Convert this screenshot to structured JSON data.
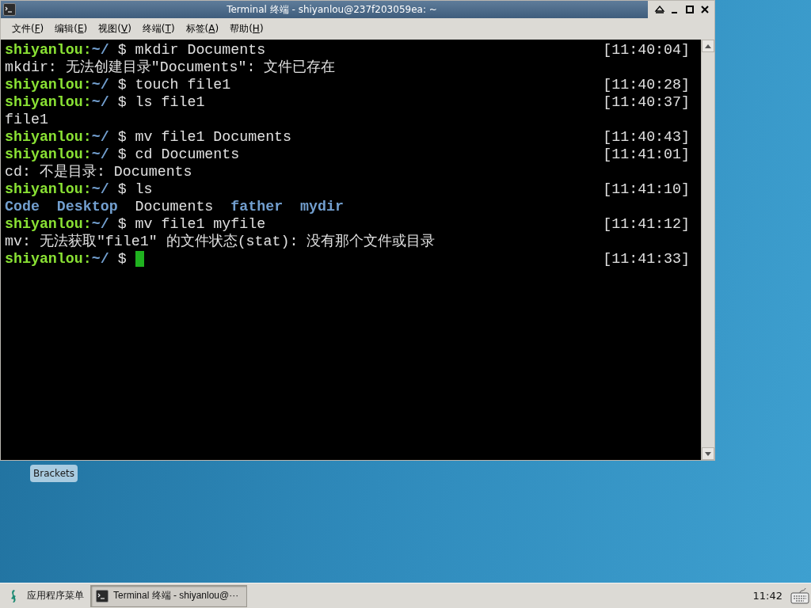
{
  "window": {
    "title": "Terminal 终端 - shiyanlou@237f203059ea: ~"
  },
  "menu": [
    "文件(F)",
    "编辑(E)",
    "视图(V)",
    "终端(T)",
    "标签(A)",
    "帮助(H)"
  ],
  "terminal": {
    "lines": [
      {
        "segments": [
          {
            "kind": "user",
            "text": "shiyanlou:"
          },
          {
            "kind": "path",
            "text": "~/"
          },
          {
            "kind": "plain",
            "text": " $ mkdir Documents"
          }
        ],
        "time": "[11:40:04]"
      },
      {
        "segments": [
          {
            "kind": "plain",
            "text": "mkdir: 无法创建目录\"Documents\": 文件已存在"
          }
        ]
      },
      {
        "segments": [
          {
            "kind": "user",
            "text": "shiyanlou:"
          },
          {
            "kind": "path",
            "text": "~/"
          },
          {
            "kind": "plain",
            "text": " $ touch file1"
          }
        ],
        "time": "[11:40:28]"
      },
      {
        "segments": [
          {
            "kind": "user",
            "text": "shiyanlou:"
          },
          {
            "kind": "path",
            "text": "~/"
          },
          {
            "kind": "plain",
            "text": " $ ls file1"
          }
        ],
        "time": "[11:40:37]"
      },
      {
        "segments": [
          {
            "kind": "plain",
            "text": "file1"
          }
        ]
      },
      {
        "segments": [
          {
            "kind": "user",
            "text": "shiyanlou:"
          },
          {
            "kind": "path",
            "text": "~/"
          },
          {
            "kind": "plain",
            "text": " $ mv file1 Documents"
          }
        ],
        "time": "[11:40:43]"
      },
      {
        "segments": [
          {
            "kind": "user",
            "text": "shiyanlou:"
          },
          {
            "kind": "path",
            "text": "~/"
          },
          {
            "kind": "plain",
            "text": " $ cd Documents"
          }
        ],
        "time": "[11:41:01]"
      },
      {
        "segments": [
          {
            "kind": "plain",
            "text": "cd: 不是目录: Documents"
          }
        ]
      },
      {
        "segments": [
          {
            "kind": "user",
            "text": "shiyanlou:"
          },
          {
            "kind": "path",
            "text": "~/"
          },
          {
            "kind": "plain",
            "text": " $ ls"
          }
        ],
        "time": "[11:41:10]"
      },
      {
        "segments": [
          {
            "kind": "dir",
            "text": "Code"
          },
          {
            "kind": "dir",
            "text": "Desktop"
          },
          {
            "kind": "plain",
            "text": "Documents"
          },
          {
            "kind": "dir",
            "text": "father"
          },
          {
            "kind": "dir",
            "text": "mydir"
          }
        ]
      },
      {
        "segments": [
          {
            "kind": "user",
            "text": "shiyanlou:"
          },
          {
            "kind": "path",
            "text": "~/"
          },
          {
            "kind": "plain",
            "text": " $ mv file1 myfile"
          }
        ],
        "time": "[11:41:12]"
      },
      {
        "segments": [
          {
            "kind": "plain",
            "text": "mv: 无法获取\"file1\" 的文件状态(stat): 没有那个文件或目录"
          }
        ]
      },
      {
        "segments": [
          {
            "kind": "user",
            "text": "shiyanlou:"
          },
          {
            "kind": "path",
            "text": "~/"
          },
          {
            "kind": "plain",
            "text": " $ "
          }
        ],
        "time": "[11:41:33]",
        "cursor": true
      }
    ]
  },
  "desktop_icons": [
    {
      "label": "Brackets"
    }
  ],
  "taskbar": {
    "app_menu": "应用程序菜单",
    "tasks": [
      {
        "label": "Terminal 终端 - shiyanlou@···",
        "selected": true
      }
    ],
    "clock": "11:42"
  }
}
